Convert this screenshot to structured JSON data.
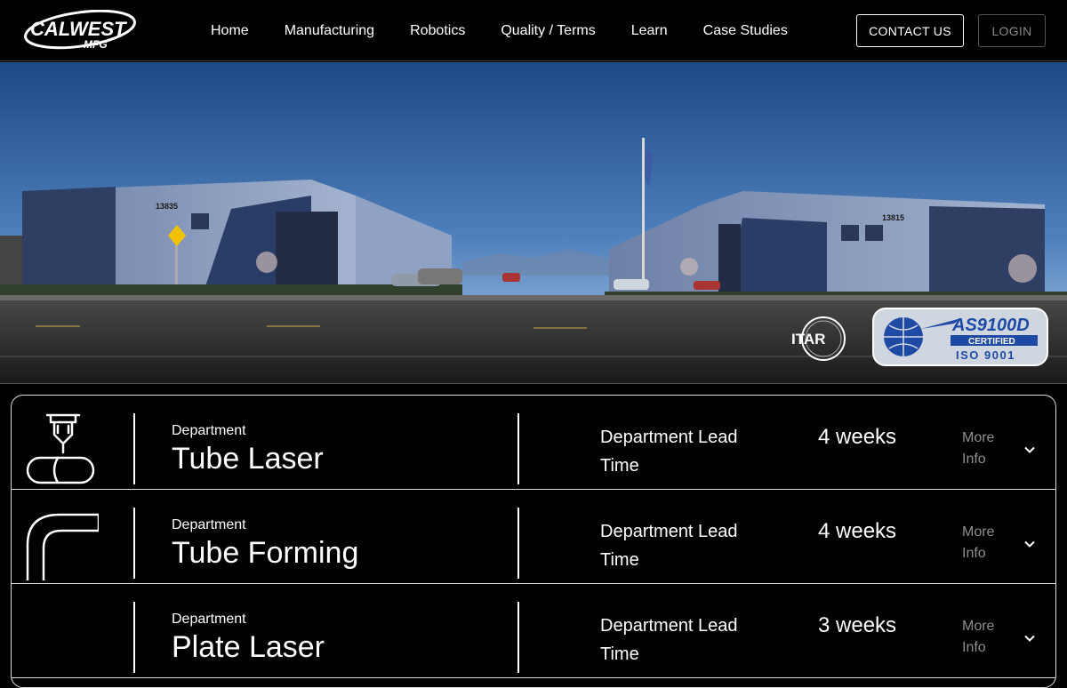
{
  "header": {
    "logo_text": "CALWEST MFG",
    "nav": [
      "Home",
      "Manufacturing",
      "Robotics",
      "Quality / Terms",
      "Learn",
      "Case Studies"
    ],
    "contact_label": "CONTACT US",
    "login_label": "LOGIN"
  },
  "hero": {
    "building_left_number": "13835",
    "building_right_number": "13815",
    "badges": {
      "itar": "ITAR",
      "as9100_title": "AS9100D",
      "as9100_certified": "CERTIFIED",
      "iso": "ISO 9001"
    }
  },
  "departments": [
    {
      "caption": "Department",
      "name": "Tube Laser",
      "lead_label": "Department Lead Time",
      "lead_value": "4 weeks",
      "more": "More Info",
      "icon": "tube-laser-icon"
    },
    {
      "caption": "Department",
      "name": "Tube Forming",
      "lead_label": "Department Lead Time",
      "lead_value": "4 weeks",
      "more": "More Info",
      "icon": "tube-bend-icon"
    },
    {
      "caption": "Department",
      "name": "Plate Laser",
      "lead_label": "Department Lead Time",
      "lead_value": "3 weeks",
      "more": "More Info",
      "icon": "plate-laser-icon"
    }
  ],
  "colors": {
    "background": "#000000",
    "sky_top": "#1f4f8c",
    "sky_bottom": "#a9c6e6",
    "building": "#3b4f78",
    "badge_blue": "#1e4aa5"
  }
}
